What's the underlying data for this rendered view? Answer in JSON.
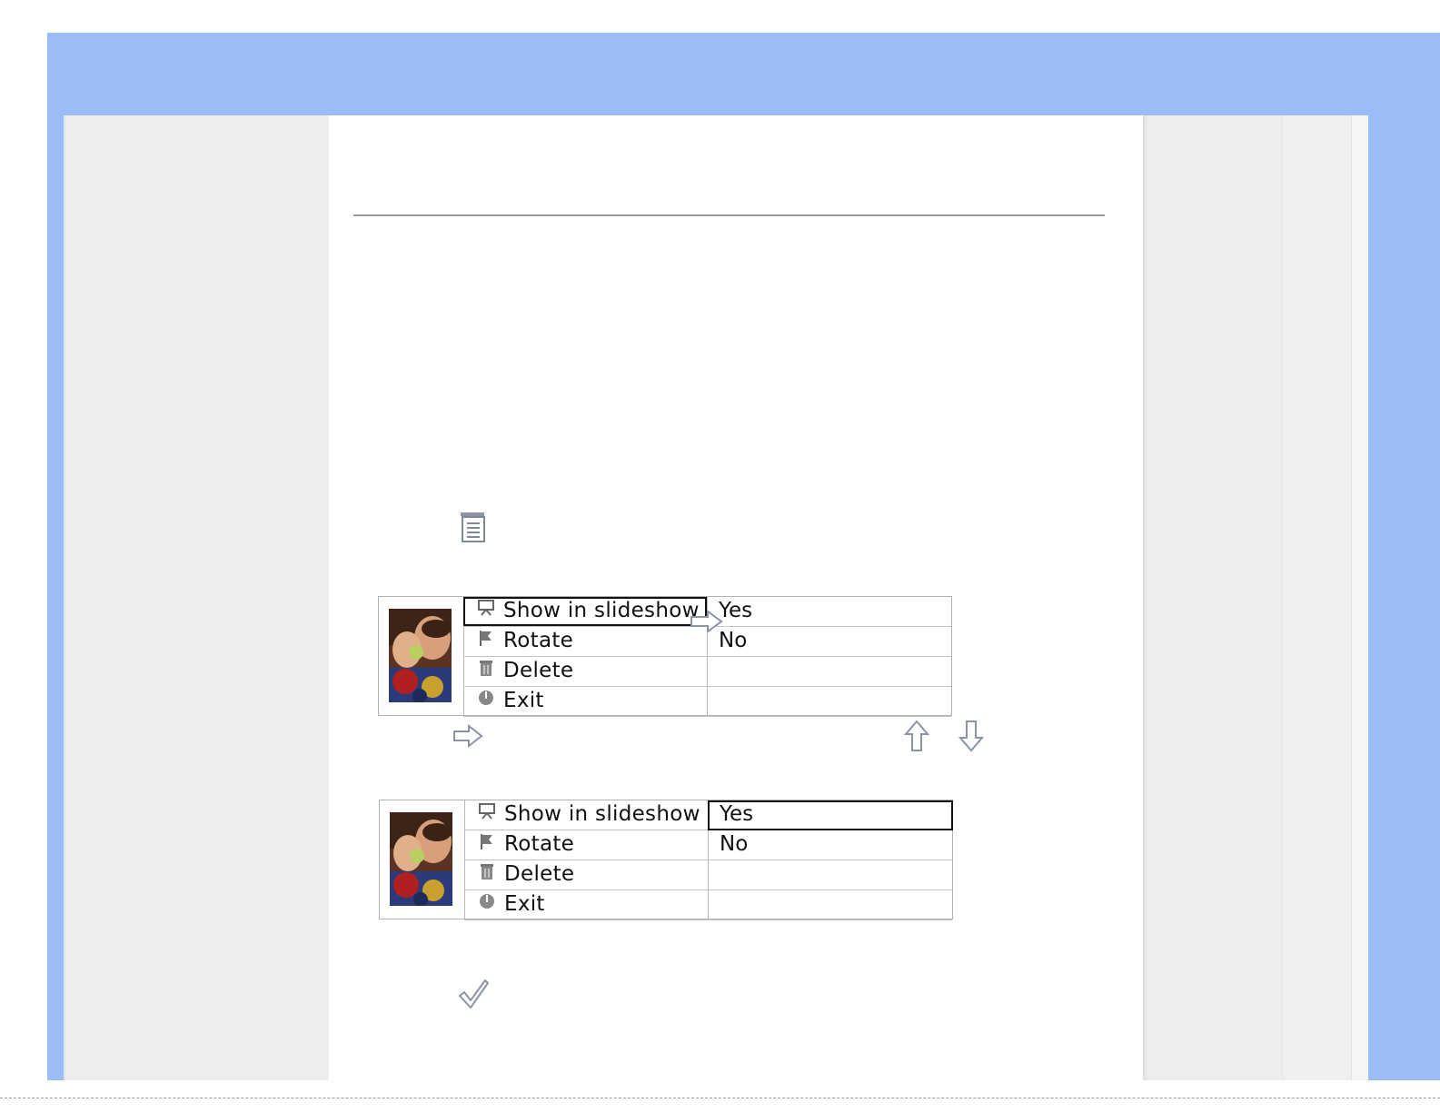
{
  "menu_items": [
    {
      "label": "Show in slideshow",
      "value": "Yes",
      "icon": "slideshow-icon"
    },
    {
      "label": "Rotate",
      "value": "No",
      "icon": "rotate-flag-icon"
    },
    {
      "label": "Delete",
      "value": "",
      "icon": "trash-icon"
    },
    {
      "label": "Exit",
      "value": "",
      "icon": "exit-icon"
    }
  ],
  "menu_step1": {
    "selected_item": "Show in slideshow"
  },
  "menu_step2": {
    "selected_value": "Yes"
  },
  "icons": {
    "menu_button": "menu-icon",
    "right_key": "right-arrow-icon",
    "up_key": "up-arrow-icon",
    "down_key": "down-arrow-icon",
    "confirm": "checkmark-icon"
  },
  "colors": {
    "frame": "#9abcf7",
    "side_panel": "#eeeeee",
    "content": "#ffffff",
    "rule": "#9b9b9b"
  }
}
